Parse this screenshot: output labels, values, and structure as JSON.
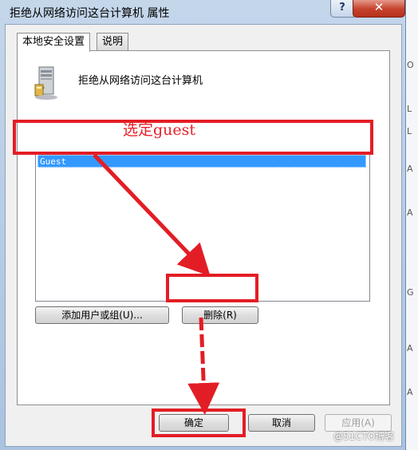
{
  "window": {
    "title": "拒绝从网络访问这台计算机 属性",
    "help_label": "?",
    "close_label": "✕"
  },
  "tabs": [
    {
      "label": "本地安全设置",
      "active": true
    },
    {
      "label": "说明",
      "active": false
    }
  ],
  "policy": {
    "icon": "server-icon",
    "title": "拒绝从网络访问这台计算机"
  },
  "annotation_text": "选定guest",
  "list": {
    "items": [
      "Guest"
    ],
    "selected_index": 0
  },
  "buttons": {
    "add": "添加用户或组(U)...",
    "remove": "删除(R)",
    "ok": "确定",
    "cancel": "取消",
    "apply": "应用(A)"
  },
  "watermark": "@51CTO博客",
  "colors": {
    "annotation_red": "#e31d25",
    "selection_blue": "#3399ff"
  }
}
